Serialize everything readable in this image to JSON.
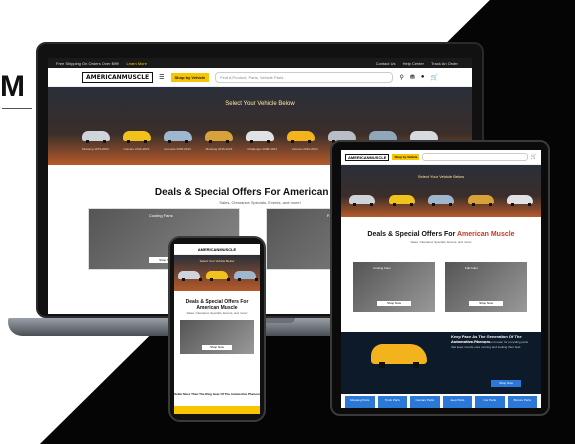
{
  "site": {
    "brand": "AMERICANMUSCLE",
    "top_bar": [
      "Free Shipping On Orders Over $99!",
      "Learn More",
      "Contact Us",
      "Help Center",
      "Track An Order"
    ],
    "shop_by_vehicle": "Shop by Vehicle",
    "search_placeholder": "Find A Product, Parts, Vehicle Parts",
    "select_vehicle": "Select Your Vehicle Below",
    "deals_title": "Deals & Special Offers For American Muscle",
    "deals_title_short": "Deals & Special Offers For",
    "deals_title_accent": "American Muscle",
    "deals_sub": "Sales, Clearance Specials, Events, and more!",
    "promo1_label": "Cooling Fans",
    "promo_btn": "Shop Now",
    "promo2_label": "Fall Color",
    "car_labels": [
      "Mustang 1979-2004",
      "Camaro 2010-2024",
      "Corvette 2005-2013",
      "Mustang 2015-2023",
      "Challenger 2008-2023",
      "Camaro 2016-2024",
      "Bronco 2021-2024",
      "Charger 2006-2023",
      "Ranger 2019-2023"
    ],
    "promo_dark_title": "Keep Pace As The Generation Of The Automotive Phenom",
    "promo_dark_text": "American Muscle has long been known for providing parts that keep muscle cars running and looking their best.",
    "promo_dark_btn": "Shop Now",
    "tiles": [
      "Mustang Parts",
      "Truck Parts",
      "Camaro Parts",
      "Jeep Parts",
      "Car Parts",
      "Bronco Parts"
    ],
    "phone_footer": "Seller More Than The Ring Gear Of The Automotive Phenom"
  },
  "colors": {
    "accent": "#f7c600",
    "blue": "#2b78d6",
    "dark": "#1a1a1a",
    "hero_orange": "#b65a2a"
  },
  "car_colors": [
    "#cfd4da",
    "#f2c21c",
    "#9fb6cf",
    "#d8a23a",
    "#e0e3e6",
    "#f2b31c",
    "#b9bec5",
    "#8fa7b8",
    "#d7d9dc"
  ],
  "icons": [
    "menu-icon",
    "search-icon",
    "user-icon",
    "cart-icon",
    "garage-icon"
  ]
}
